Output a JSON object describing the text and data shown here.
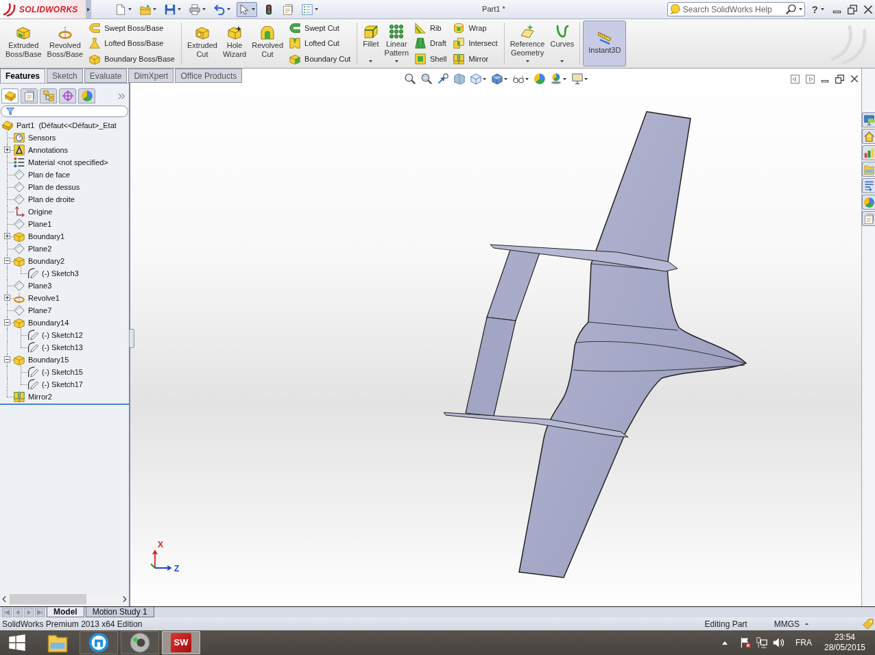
{
  "app": {
    "logo_text": "SOLIDWORKS",
    "title": "Part1 *",
    "search": {
      "placeholder": "Search SolidWorks Help"
    },
    "help": "?"
  },
  "quick_access": [
    {
      "selected": false
    },
    {
      "selected": false
    },
    {
      "selected": false
    },
    {
      "selected": false
    },
    {
      "selected": false
    },
    {
      "selected": true
    },
    {
      "selected": false
    },
    {
      "selected": false
    },
    {
      "selected": false
    }
  ],
  "command_manager": {
    "groups": [
      {
        "items": [
          {
            "kind": "large",
            "label": "Extruded\nBoss/Base"
          },
          {
            "kind": "large",
            "label": "Revolved\nBoss/Base"
          },
          {
            "kind": "small",
            "label": "Swept Boss/Base"
          },
          {
            "kind": "small",
            "label": "Lofted Boss/Base"
          },
          {
            "kind": "small",
            "label": "Boundary Boss/Base"
          }
        ]
      },
      {
        "items": [
          {
            "kind": "large",
            "label": "Extruded\nCut"
          },
          {
            "kind": "large",
            "label": "Hole\nWizard"
          },
          {
            "kind": "large",
            "label": "Revolved\nCut"
          },
          {
            "kind": "small",
            "label": "Swept Cut"
          },
          {
            "kind": "small",
            "label": "Lofted Cut"
          },
          {
            "kind": "small",
            "label": "Boundary Cut"
          }
        ]
      },
      {
        "items": [
          {
            "kind": "large",
            "label": "Fillet",
            "has_menu": true
          },
          {
            "kind": "large",
            "label": "Linear\nPattern",
            "has_menu": true
          },
          {
            "kind": "small",
            "label": "Rib"
          },
          {
            "kind": "small",
            "label": "Draft"
          },
          {
            "kind": "small",
            "label": "Shell"
          },
          {
            "kind": "small",
            "label": "Wrap"
          },
          {
            "kind": "small",
            "label": "Intersect"
          },
          {
            "kind": "small",
            "label": "Mirror"
          }
        ]
      },
      {
        "items": [
          {
            "kind": "large",
            "label": "Reference\nGeometry",
            "has_menu": true
          },
          {
            "kind": "large",
            "label": "Curves",
            "has_menu": true
          }
        ]
      },
      {
        "items": [
          {
            "kind": "large",
            "label": "Instant3D",
            "pressed": true
          }
        ]
      }
    ],
    "tabs": [
      {
        "label": "Features",
        "selected": true
      },
      {
        "label": "Sketch",
        "selected": false
      },
      {
        "label": "Evaluate",
        "selected": false
      },
      {
        "label": "DimXpert",
        "selected": false
      },
      {
        "label": "Office Products",
        "selected": false
      }
    ]
  },
  "feature_manager": {
    "tabs": [
      {
        "selected": true
      },
      {
        "selected": false
      },
      {
        "selected": false
      },
      {
        "selected": false
      },
      {
        "selected": false
      }
    ],
    "tree": {
      "label": "Part1  (Défaut<<Défaut>_Etat",
      "kind": "part",
      "children": [
        {
          "label": "Sensors",
          "kind": "sensors"
        },
        {
          "label": "Annotations",
          "kind": "annotations",
          "expanded": false
        },
        {
          "label": "Material <not specified>",
          "kind": "material"
        },
        {
          "label": "Plan de face",
          "kind": "plane"
        },
        {
          "label": "Plan de dessus",
          "kind": "plane"
        },
        {
          "label": "Plan de droite",
          "kind": "plane"
        },
        {
          "label": "Origine",
          "kind": "origin"
        },
        {
          "label": "Plane1",
          "kind": "plane"
        },
        {
          "label": "Boundary1",
          "kind": "boundary",
          "expanded": false
        },
        {
          "label": "Plane2",
          "kind": "plane"
        },
        {
          "label": "Boundary2",
          "kind": "boundary",
          "expanded": true,
          "children": [
            {
              "label": "(-) Sketch3",
              "kind": "sketch"
            }
          ]
        },
        {
          "label": "Plane3",
          "kind": "plane"
        },
        {
          "label": "Revolve1",
          "kind": "revolve",
          "expanded": false
        },
        {
          "label": "Plane7",
          "kind": "plane"
        },
        {
          "label": "Boundary14",
          "kind": "boundary",
          "expanded": true,
          "children": [
            {
              "label": "(-) Sketch12",
              "kind": "sketch"
            },
            {
              "label": "(-) Sketch13",
              "kind": "sketch"
            }
          ]
        },
        {
          "label": "Boundary15",
          "kind": "boundary",
          "expanded": true,
          "children": [
            {
              "label": "(-) Sketch15",
              "kind": "sketch"
            },
            {
              "label": "(-) Sketch17",
              "kind": "sketch"
            }
          ]
        },
        {
          "label": "Mirror2",
          "kind": "mirror"
        }
      ]
    }
  },
  "viewport": {
    "triad": [
      {
        "text": "X",
        "color": "#e02020"
      },
      {
        "text": "Z",
        "color": "#2040d0"
      }
    ]
  },
  "document_tabs": [
    {
      "label": "Model",
      "selected": true
    },
    {
      "label": "Motion Study 1",
      "selected": false
    }
  ],
  "status_bar": {
    "product": "SolidWorks Premium 2013 x64 Edition",
    "mode": "Editing Part",
    "units": "MMGS"
  },
  "taskbar": {
    "apps": [
      {
        "running": false,
        "active": false
      },
      {
        "running": true,
        "active": false
      },
      {
        "running": true,
        "active": false
      },
      {
        "running": true,
        "active": true,
        "label": "SW"
      }
    ],
    "language": "FRA",
    "time": "23:54",
    "date": "28/05/2015"
  }
}
